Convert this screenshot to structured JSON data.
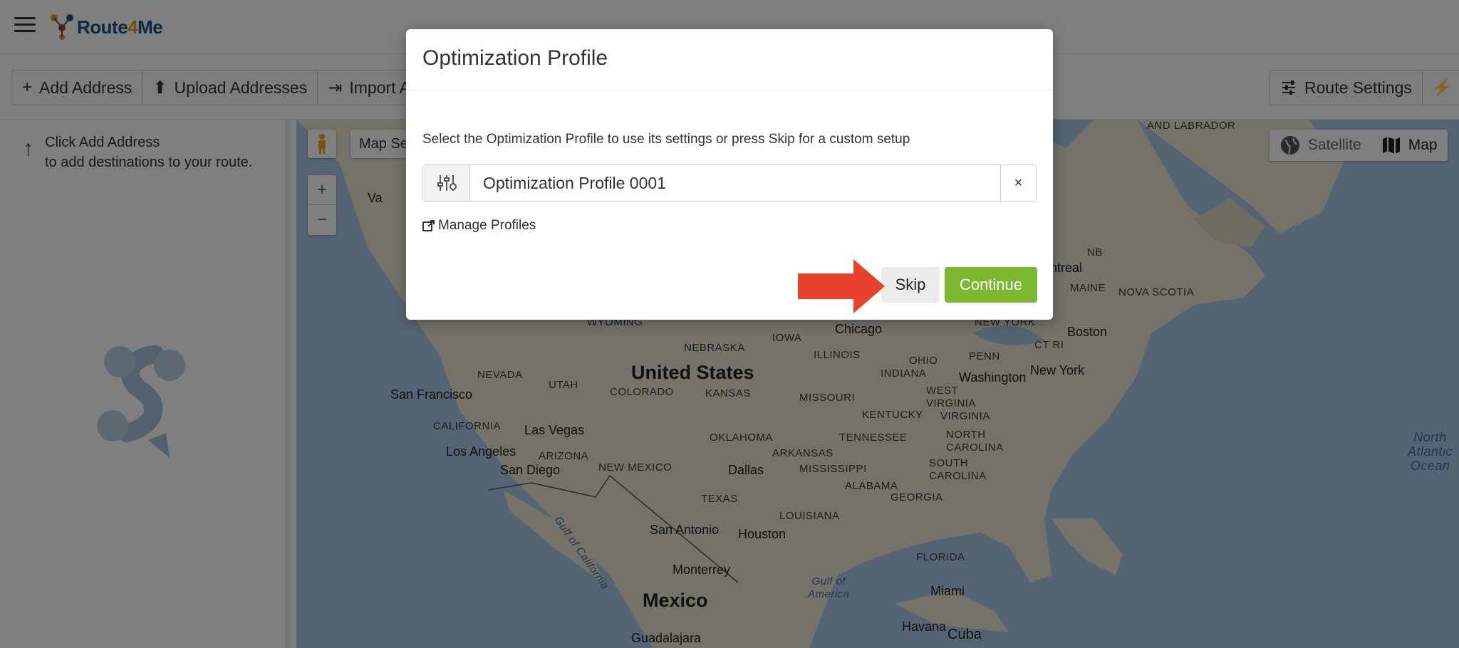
{
  "app": {
    "logo_text_a": "Route",
    "logo_text_b": "4",
    "logo_text_c": "Me"
  },
  "toolbar": {
    "add_address": "Add Address",
    "upload_addresses": "Upload Addresses",
    "import_addresses": "Import A",
    "route_settings": "Route Settings"
  },
  "sidebar": {
    "hint_line1": "Click Add Address",
    "hint_line2": "to add destinations to your route."
  },
  "map": {
    "search_label": "Map Se",
    "satellite": "Satellite",
    "map": "Map",
    "labels": {
      "united_states": "United States",
      "mexico": "Mexico",
      "chicago": "Chicago",
      "boston": "Boston",
      "new_york": "New York",
      "washington": "Washington",
      "san_francisco": "San Francisco",
      "las_vegas": "Las Vegas",
      "los_angeles": "Los Angeles",
      "san_diego": "San Diego",
      "dallas": "Dallas",
      "houston": "Houston",
      "san_antonio": "San Antonio",
      "monterrey": "Monterrey",
      "miami": "Miami",
      "havana": "Havana",
      "cuba": "Cuba",
      "guadalajara": "Guadalajara",
      "montreal": "ontreal",
      "nevada": "NEVADA",
      "utah": "UTAH",
      "colorado": "COLORADO",
      "kansas": "KANSAS",
      "nebraska": "NEBRASKA",
      "wyoming": "WYOMING",
      "iowa": "IOWA",
      "illinois": "ILLINOIS",
      "missouri": "MISSOURI",
      "indiana": "INDIANA",
      "ohio": "OHIO",
      "penn": "PENN",
      "ny_state": "NEW YORK",
      "maine": "MAINE",
      "nova_scotia": "NOVA SCOTIA",
      "nb": "NB",
      "ct_ri": "CT RI",
      "west_virginia": "WEST\nVIRGINIA",
      "virginia": "VIRGINIA",
      "kentucky": "KENTUCKY",
      "tennessee": "TENNESSEE",
      "north_carolina": "NORTH\nCAROLINA",
      "south_carolina": "SOUTH\nCAROLINA",
      "georgia": "GEORGIA",
      "alabama": "ALABAMA",
      "mississippi": "MISSISSIPPI",
      "arkansas": "ARKANSAS",
      "louisiana": "LOUISIANA",
      "oklahoma": "OKLAHOMA",
      "texas": "TEXAS",
      "new_mexico": "NEW MEXICO",
      "arizona": "ARIZONA",
      "california": "CALIFORNIA",
      "florida": "FLORIDA",
      "gulf_of_america": "Gulf of\nAmerica",
      "gulf_of_california": "Gulf of California",
      "north_atlantic": "North\nAtlantic\nOcean",
      "labrador": "AND LABRADOR",
      "va": "Va"
    }
  },
  "modal": {
    "title": "Optimization Profile",
    "description": "Select the Optimization Profile to use its settings or press Skip for a custom setup",
    "profile_value": "Optimization Profile 0001",
    "clear_label": "×",
    "manage_profiles": "Manage Profiles",
    "skip": "Skip",
    "continue": "Continue"
  },
  "colors": {
    "continue_green": "#7cb82f",
    "arrow_red": "#e8412c",
    "brand_blue": "#1d4f87",
    "brand_orange": "#e89b1d"
  }
}
